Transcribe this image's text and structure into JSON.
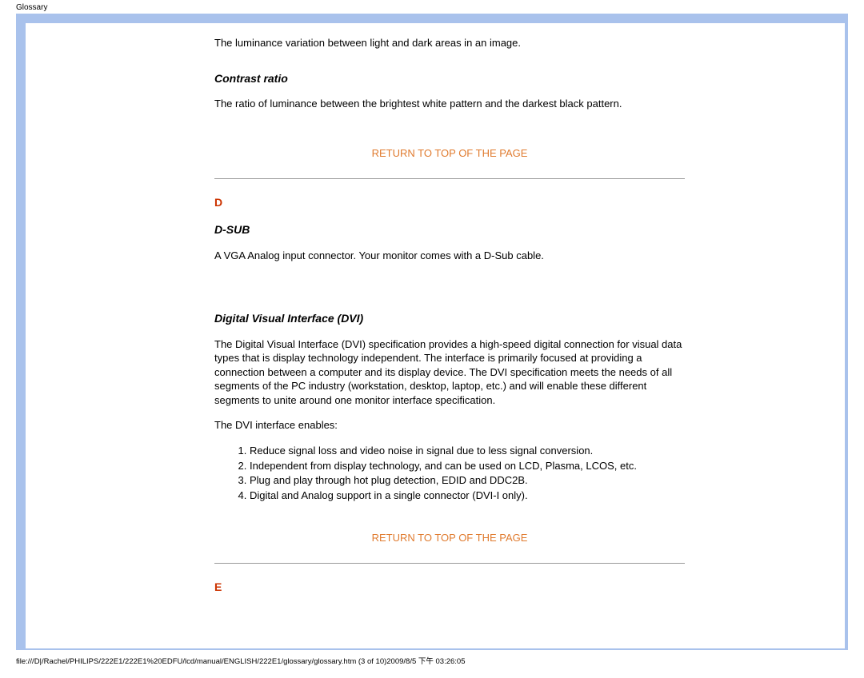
{
  "header": {
    "title": "Glossary"
  },
  "content": {
    "intro_para": "The luminance variation between light and dark areas in an image.",
    "contrast": {
      "heading": "Contrast ratio",
      "body": "The ratio of luminance between the brightest white pattern and the darkest black pattern."
    },
    "return_top": "RETURN TO TOP OF THE PAGE",
    "letter_d": "D",
    "dsub": {
      "heading": "D-SUB",
      "body": "A VGA Analog input connector. Your monitor comes with a D-Sub cable."
    },
    "dvi": {
      "heading": "Digital Visual Interface (DVI)",
      "body": "The Digital Visual Interface (DVI) specification provides a high-speed digital connection for visual data types that is display technology independent. The interface is primarily focused at providing a connection between a computer and its display device. The DVI specification meets the needs of all segments of the PC industry (workstation, desktop, laptop, etc.) and will enable these different segments to unite around one monitor interface specification.",
      "enables_intro": "The DVI interface enables:",
      "items": [
        "Reduce signal loss and video noise in signal due to less signal conversion.",
        "Independent from display technology, and can be used on LCD, Plasma, LCOS, etc.",
        "Plug and play through hot plug detection, EDID and DDC2B.",
        "Digital and Analog support in a single connector (DVI-I only)."
      ]
    },
    "letter_e": "E"
  },
  "footer": {
    "path": "file:///D|/Rachel/PHILIPS/222E1/222E1%20EDFU/lcd/manual/ENGLISH/222E1/glossary/glossary.htm (3 of 10)2009/8/5 下午 03:26:05"
  }
}
